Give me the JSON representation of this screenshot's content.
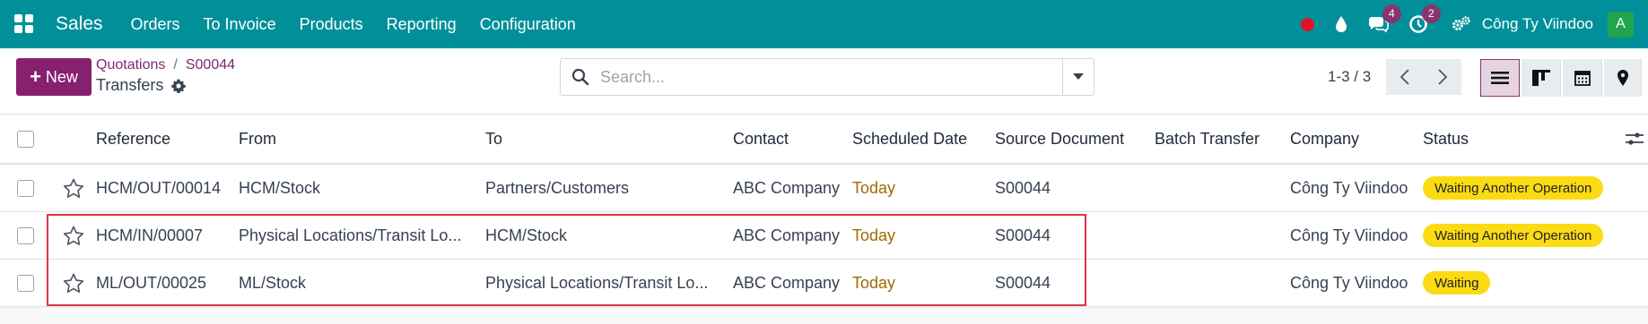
{
  "topbar": {
    "app_name": "Sales",
    "menu": [
      "Orders",
      "To Invoice",
      "Products",
      "Reporting",
      "Configuration"
    ],
    "badges": {
      "messages": "4",
      "activities": "2"
    },
    "company": "Công Ty Viindoo",
    "avatar_letter": "A",
    "colors": {
      "bar": "#01909a",
      "badge": "#87346f",
      "record": "#e5112b",
      "avatar": "#21a44d"
    }
  },
  "control_panel": {
    "new_label": "New",
    "breadcrumb": [
      "Quotations",
      "S00044"
    ],
    "title": "Transfers",
    "search_placeholder": "Search...",
    "pager": "1-3 / 3",
    "views": [
      "list-view-icon",
      "kanban-view-icon",
      "calendar-view-icon",
      "map-view-icon"
    ],
    "active_view": "list"
  },
  "table": {
    "columns": [
      "Reference",
      "From",
      "To",
      "Contact",
      "Scheduled Date",
      "Source Document",
      "Batch Transfer",
      "Company",
      "Status"
    ],
    "rows": [
      {
        "reference": "HCM/OUT/00014",
        "from": "HCM/Stock",
        "to": "Partners/Customers",
        "contact": "ABC Company",
        "scheduled": "Today",
        "source": "S00044",
        "batch": "",
        "company": "Công Ty Viindoo",
        "status": "Waiting Another Operation"
      },
      {
        "reference": "HCM/IN/00007",
        "from": "Physical Locations/Transit Lo...",
        "to": "HCM/Stock",
        "contact": "ABC Company",
        "scheduled": "Today",
        "source": "S00044",
        "batch": "",
        "company": "Công Ty Viindoo",
        "status": "Waiting Another Operation"
      },
      {
        "reference": "ML/OUT/00025",
        "from": "ML/Stock",
        "to": "Physical Locations/Transit Lo...",
        "contact": "ABC Company",
        "scheduled": "Today",
        "source": "S00044",
        "batch": "",
        "company": "Công Ty Viindoo",
        "status": "Waiting"
      }
    ],
    "colors": {
      "today": "#a06a00",
      "status_badge": "#fadb14",
      "highlight": "#dc3545"
    }
  }
}
